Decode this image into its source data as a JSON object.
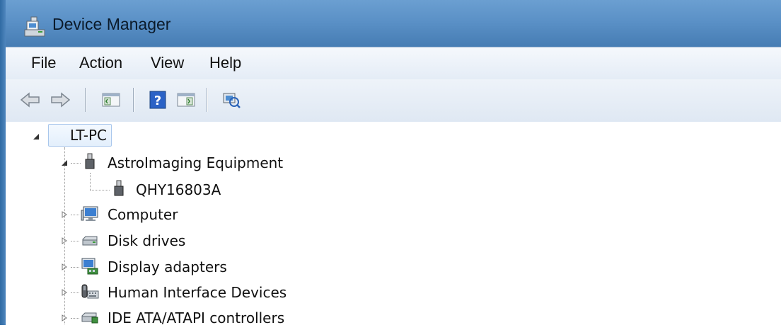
{
  "window": {
    "title": "Device Manager"
  },
  "menu": {
    "items": [
      "File",
      "Action",
      "View",
      "Help"
    ]
  },
  "toolbar": {
    "buttons": [
      "back-arrow-icon",
      "forward-arrow-icon",
      "show-hide-console-tree-icon",
      "help-icon",
      "show-hide-action-pane-icon",
      "scan-hardware-changes-icon"
    ]
  },
  "tree": {
    "root": "LT-PC",
    "nodes": [
      {
        "label": "AstroImaging Equipment",
        "expanded": true,
        "children": [
          "QHY16803A"
        ]
      },
      {
        "label": "Computer",
        "expanded": false
      },
      {
        "label": "Disk drives",
        "expanded": false
      },
      {
        "label": "Display adapters",
        "expanded": false
      },
      {
        "label": "Human Interface Devices",
        "expanded": false
      },
      {
        "label": "IDE ATA/ATAPI controllers",
        "expanded": false
      }
    ]
  },
  "colors": {
    "titlebar": "#5a90c6",
    "selection": "#e3effc",
    "text": "#111111"
  }
}
